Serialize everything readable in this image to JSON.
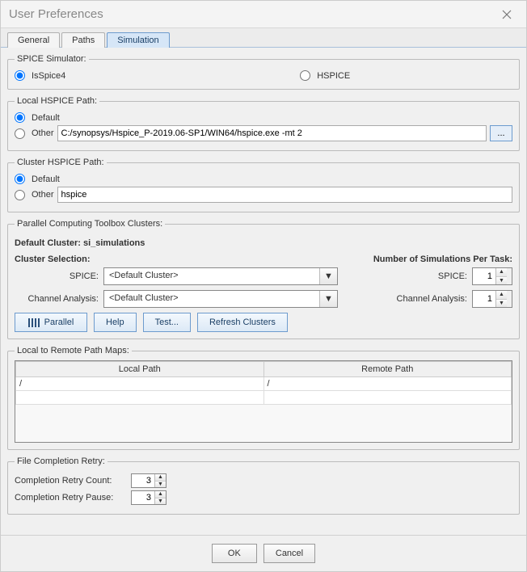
{
  "titlebar": {
    "title": "User Preferences"
  },
  "tabs": {
    "general": "General",
    "paths": "Paths",
    "simulation": "Simulation"
  },
  "spice_sim": {
    "legend": "SPICE Simulator:",
    "isspice": "IsSpice4",
    "hspice": "HSPICE"
  },
  "local_hpath": {
    "legend": "Local HSPICE Path:",
    "default": "Default",
    "other": "Other",
    "other_value": "C:/synopsys/Hspice_P-2019.06-SP1/WIN64/hspice.exe -mt 2",
    "browse": "..."
  },
  "cluster_hpath": {
    "legend": "Cluster HSPICE Path:",
    "default": "Default",
    "other": "Other",
    "other_value": "hspice"
  },
  "pct": {
    "legend": "Parallel Computing Toolbox Clusters:",
    "default_cluster_label": "Default Cluster: si_simulations",
    "cluster_selection_label": "Cluster Selection:",
    "sims_per_task_label": "Number of Simulations Per Task:",
    "spice_label": "SPICE:",
    "spice_cluster": "<Default Cluster>",
    "spice_num": "1",
    "ca_label": "Channel Analysis:",
    "ca_cluster": "<Default Cluster>",
    "ca_num": "1",
    "btn_parallel": "Parallel",
    "btn_help": "Help",
    "btn_test": "Test...",
    "btn_refresh": "Refresh Clusters"
  },
  "pathmap": {
    "legend": "Local to Remote Path Maps:",
    "col_local": "Local Path",
    "col_remote": "Remote Path",
    "row0_local": "/",
    "row0_remote": "/"
  },
  "retry": {
    "legend": "File Completion Retry:",
    "count_label": "Completion Retry Count:",
    "count_val": "3",
    "pause_label": "Completion Retry Pause:",
    "pause_val": "3"
  },
  "footer": {
    "ok": "OK",
    "cancel": "Cancel"
  }
}
